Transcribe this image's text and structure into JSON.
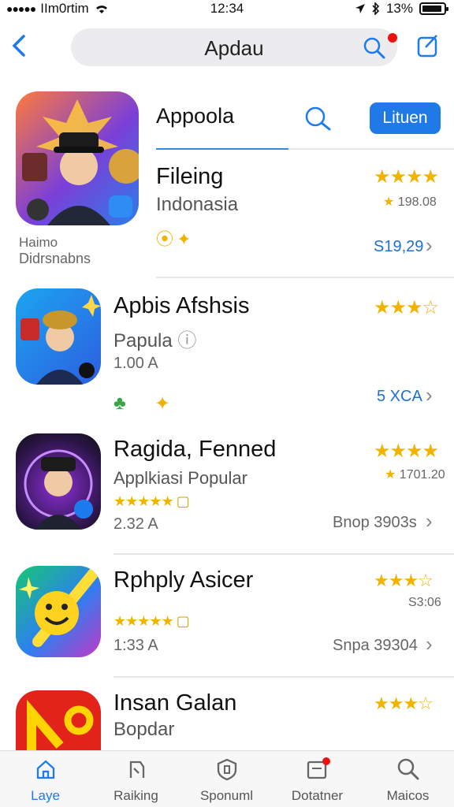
{
  "status": {
    "carrier": "IIm0rtim",
    "time": "12:34",
    "battery": "13%"
  },
  "nav": {
    "title": "Apdau"
  },
  "featured": {
    "name": "Appoola",
    "button": "Lituen",
    "title": "Fileing",
    "region": "Indonasia",
    "rating_count": "198.08",
    "price": "S19,29",
    "caption1": "Haimo",
    "caption2": "Didrsnabns"
  },
  "apps": [
    {
      "name": "Apbis Afshsis",
      "sub": "Papula",
      "size": "1.00 A",
      "price": "5 XCA",
      "stars": "★★★☆"
    },
    {
      "name": "Ragida, Fenned",
      "sub": "Applkiasi Popular",
      "size": "2.32 A",
      "meta": "Bnop 3903s",
      "rating": "1701.20",
      "stars": "★★★★"
    },
    {
      "name": "Rphply Asicer",
      "size": "1:33 A",
      "meta": "Snpa 39304",
      "rating": "S3:06",
      "stars": "★★★☆"
    },
    {
      "name": "Insan Galan",
      "sub": "Bopdar",
      "stars": "★★★☆"
    }
  ],
  "tabs": [
    "Laye",
    "Raiking",
    "Sponuml",
    "Dotatner",
    "Maicos"
  ],
  "colors": {
    "accent": "#1d7bf0",
    "star": "#f2b200"
  }
}
